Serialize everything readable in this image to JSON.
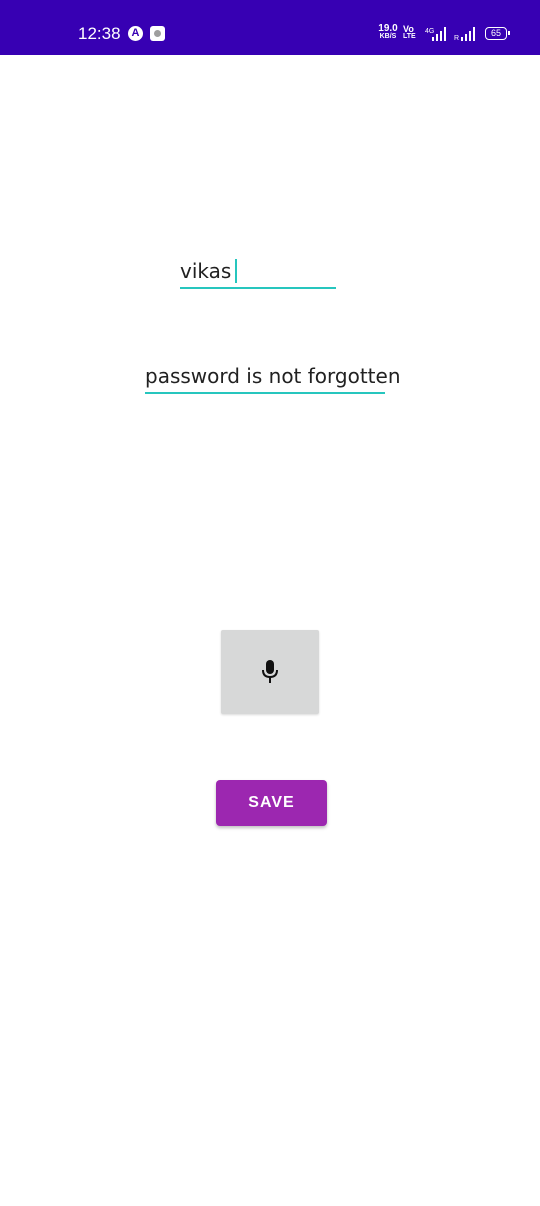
{
  "status_bar": {
    "time": "12:38",
    "net_speed_value": "19.0",
    "net_speed_unit": "KB/S",
    "volte_top": "Vo",
    "volte_bottom": "LTE",
    "network_type": "4G",
    "roaming": "R",
    "battery_level": "65",
    "background_color": "#3700b3"
  },
  "form": {
    "username_value": "vikas",
    "password_value": "password is not forgotten",
    "underline_color": "#26c6be"
  },
  "mic_button": {
    "icon": "microphone-icon",
    "background_color": "#d7d8d8"
  },
  "save_button": {
    "label": "SAVE",
    "background_color": "#9c27b0"
  }
}
